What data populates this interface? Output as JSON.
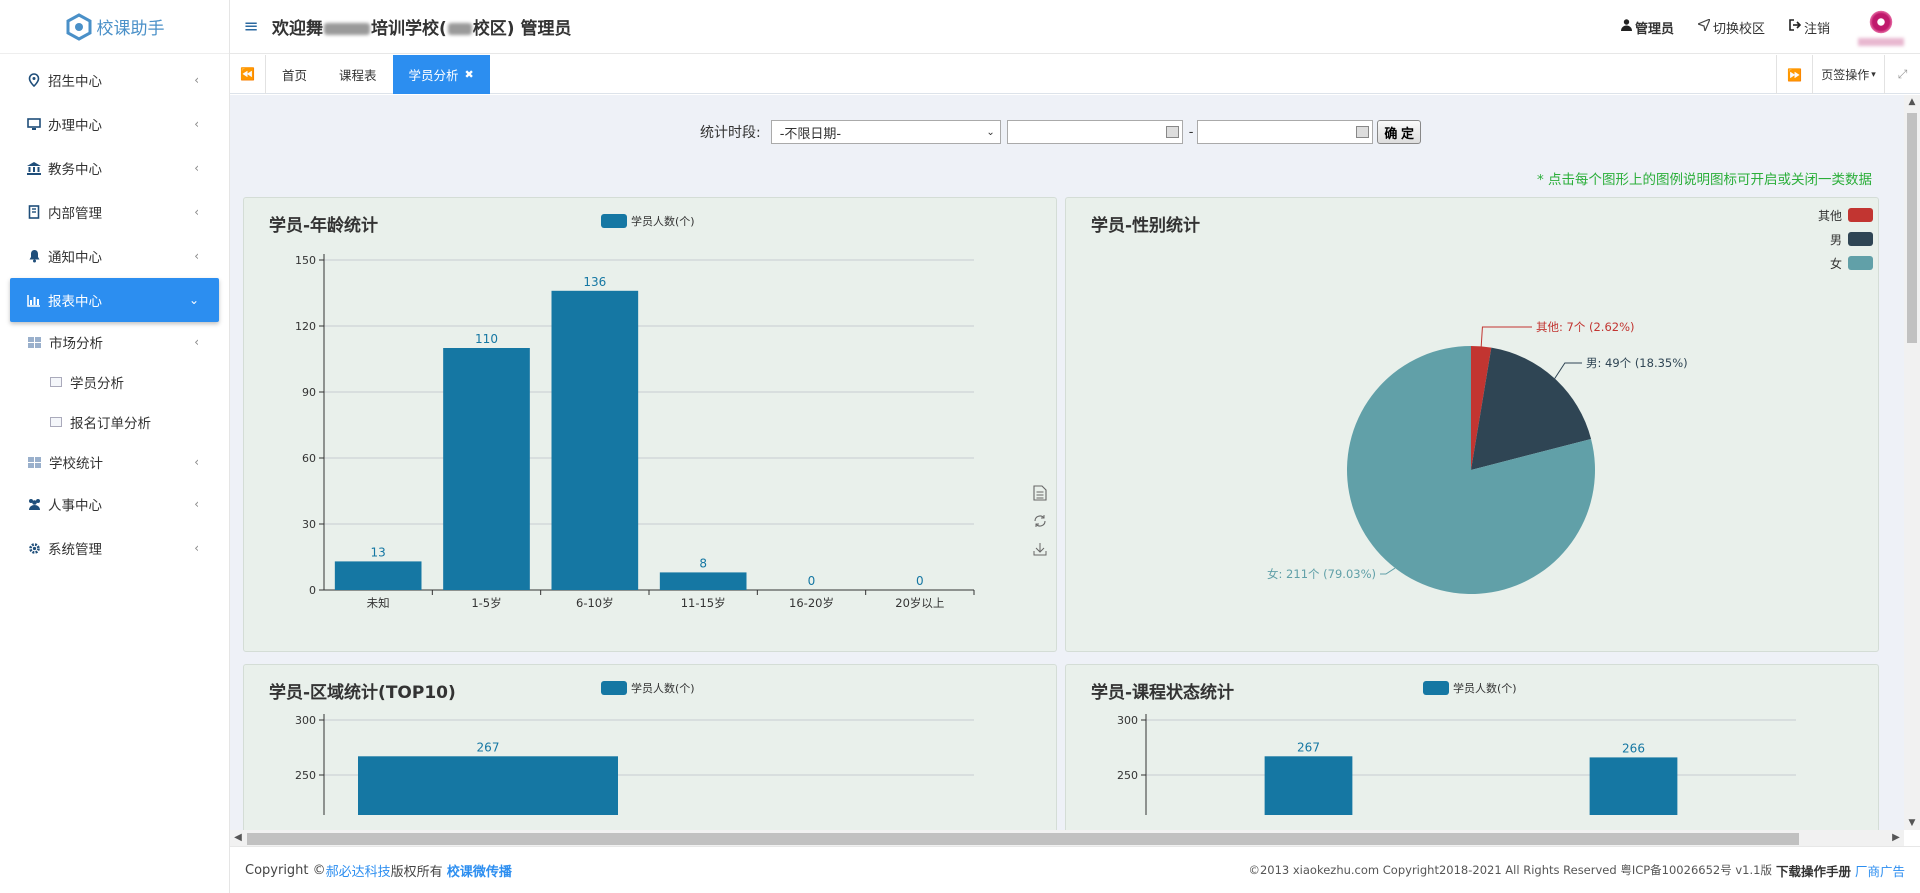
{
  "app": {
    "logo_text": "校课助手",
    "welcome_prefix": "欢迎舞",
    "welcome_mid": "培训学校(",
    "welcome_suffix": "校区) 管理员"
  },
  "header": {
    "admin_label": "管理员",
    "switch_campus_label": "切换校区",
    "logout_label": "注销"
  },
  "sidebar": {
    "items": [
      {
        "label": "招生中心",
        "icon": "map-pin-icon"
      },
      {
        "label": "办理中心",
        "icon": "monitor-icon"
      },
      {
        "label": "教务中心",
        "icon": "bank-icon"
      },
      {
        "label": "内部管理",
        "icon": "book-icon"
      },
      {
        "label": "通知中心",
        "icon": "bell-icon"
      },
      {
        "label": "报表中心",
        "icon": "bar-chart-icon"
      }
    ],
    "report_sub": {
      "market": "市场分析",
      "student_analysis": "学员分析",
      "order_analysis": "报名订单分析",
      "school_stats": "学校统计"
    },
    "after_items": [
      {
        "label": "人事中心",
        "icon": "users-icon"
      },
      {
        "label": "系统管理",
        "icon": "gear-icon"
      }
    ]
  },
  "tabs": {
    "items": [
      "首页",
      "课程表",
      "学员分析"
    ],
    "active_index": 2,
    "page_ops_label": "页签操作"
  },
  "filter": {
    "label": "统计时段:",
    "period_value": "-不限日期-",
    "date_from": "",
    "date_to": "",
    "separator": "-",
    "confirm_label": "确 定"
  },
  "hint": "* 点击每个图形上的图例说明图标可开启或关闭一类数据",
  "chart_data": [
    {
      "type": "bar",
      "title": "学员-年龄统计",
      "series": [
        {
          "name": "学员人数(个)",
          "values": [
            13,
            110,
            136,
            8,
            0,
            0
          ]
        }
      ],
      "categories": [
        "未知",
        "1-5岁",
        "6-10岁",
        "11-15岁",
        "16-20岁",
        "20岁以上"
      ],
      "yticks": [
        0,
        30,
        60,
        90,
        120,
        150
      ],
      "ylim": [
        0,
        150
      ],
      "color": "#1577a3",
      "grid": true,
      "legend": "top-center"
    },
    {
      "type": "pie",
      "title": "学员-性别统计",
      "slices": [
        {
          "name": "其他",
          "value": 7,
          "label": "其他: 7个 (2.62%)",
          "color": "#c23531"
        },
        {
          "name": "男",
          "value": 49,
          "label": "男: 49个 (18.35%)",
          "color": "#2f4554"
        },
        {
          "name": "女",
          "value": 211,
          "label": "女: 211个 (79.03%)",
          "color": "#61a0a8"
        }
      ],
      "legend": "top-right"
    },
    {
      "type": "bar",
      "title": "学员-区域统计(TOP10)",
      "series": [
        {
          "name": "学员人数(个)",
          "values": [
            267
          ]
        }
      ],
      "yticks": [
        250,
        300
      ],
      "ylim": [
        0,
        300
      ],
      "color": "#1577a3",
      "grid": true,
      "legend": "top-center"
    },
    {
      "type": "bar",
      "title": "学员-课程状态统计",
      "series": [
        {
          "name": "学员人数(个)",
          "values": [
            267,
            266
          ]
        }
      ],
      "yticks": [
        250,
        300
      ],
      "ylim": [
        0,
        300
      ],
      "color": "#1577a3",
      "grid": true,
      "legend": "top-center"
    }
  ],
  "footer": {
    "copyright_prefix": "Copyright ©",
    "company_link": "郝必达科技",
    "rights_text": "版权所有",
    "brand_link": "校课微传播",
    "right_text": "©2013 xiaokezhu.com Copyright2018-2021 All Rights Reserved 粤ICP备10026652号 v1.1版",
    "download_label": "下载操作手册",
    "vendor_ad": "厂商广告"
  }
}
